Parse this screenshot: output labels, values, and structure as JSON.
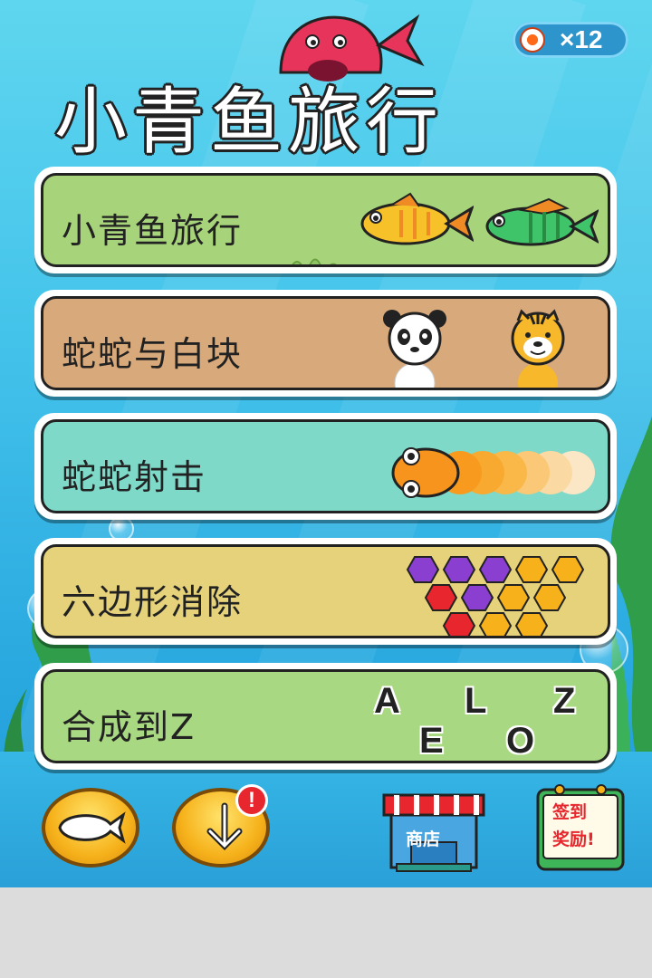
{
  "header": {
    "coin_count": "×12",
    "title": "小青鱼旅行"
  },
  "games": [
    {
      "label": "小青鱼旅行"
    },
    {
      "label": "蛇蛇与白块"
    },
    {
      "label": "蛇蛇射击"
    },
    {
      "label": "六边形消除"
    },
    {
      "label": "合成到Z",
      "letters": [
        "A",
        "L",
        "Z",
        "E",
        "O"
      ]
    }
  ],
  "footer": {
    "shop_label": "商店",
    "checkin_line1": "签到",
    "checkin_line2": "奖励!",
    "notification_badge": "!"
  },
  "colors": {
    "card_green": "#a7d47a",
    "card_tan": "#d8a97a",
    "card_teal": "#7fd9c9",
    "card_yellow": "#e5d27a",
    "accent_red": "#e8262d",
    "title_accent_green": "#2a9a3a"
  }
}
